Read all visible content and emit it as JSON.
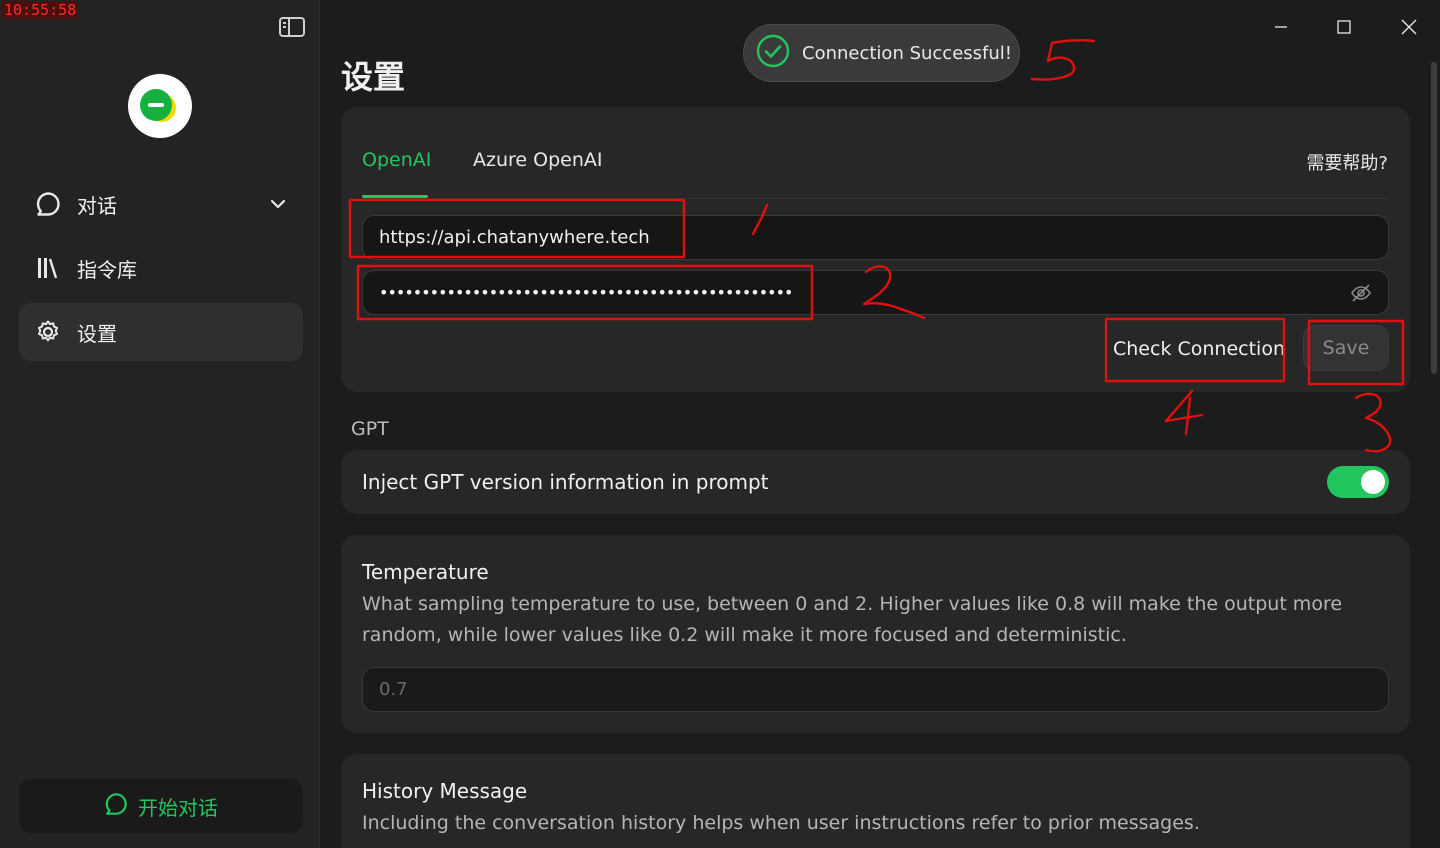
{
  "clock": "10:55:58",
  "sidebar": {
    "items": [
      {
        "label": "对话",
        "icon": "chat-icon"
      },
      {
        "label": "指令库",
        "icon": "library-icon"
      },
      {
        "label": "设置",
        "icon": "gear-icon"
      }
    ],
    "start_button": "开始对话"
  },
  "page_title": "设置",
  "toast": {
    "message": "Connection Successful!"
  },
  "api_card": {
    "tabs": [
      "OpenAI",
      "Azure OpenAI"
    ],
    "help": "需要帮助?",
    "url_value": "https://api.chatanywhere.tech",
    "key_value": "•••••••••••••••••••••••••••••••••••••••••••••••••",
    "check_label": "Check Connection",
    "save_label": "Save"
  },
  "gpt_section": "GPT",
  "inject": {
    "label": "Inject GPT version information in prompt",
    "enabled": true
  },
  "temperature": {
    "title": "Temperature",
    "description": "What sampling temperature to use, between 0 and 2. Higher values like 0.8 will make the output more random, while lower values like 0.2 will make it more focused and deterministic.",
    "placeholder": "0.7"
  },
  "history": {
    "title": "History Message",
    "description": "Including the conversation history helps when user instructions refer to prior messages."
  },
  "colors": {
    "accent": "#22c55e",
    "annotation": "#e01010"
  }
}
